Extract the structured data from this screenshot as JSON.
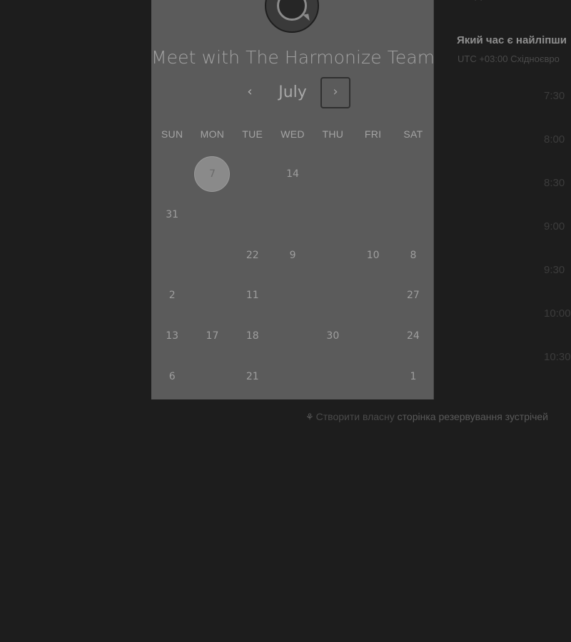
{
  "booking": {
    "title": "Meet with The Harmonize Team",
    "month": "July",
    "prev_icon": "‹",
    "next_icon": "›"
  },
  "calendar": {
    "weekdays": [
      "SUN",
      "MON",
      "TUE",
      "WED",
      "THU",
      "FRI",
      "SAT"
    ],
    "weeks": [
      [
        "",
        "7",
        "",
        "14",
        "",
        "",
        ""
      ],
      [
        "31",
        "",
        "",
        "",
        "",
        "",
        ""
      ],
      [
        "",
        "",
        "22",
        "9",
        "",
        "10",
        "8"
      ],
      [
        "2",
        "",
        "11",
        "",
        "",
        "",
        "27"
      ],
      [
        "13",
        "17",
        "18",
        "",
        "30",
        "",
        "24"
      ],
      [
        "6",
        "",
        "21",
        "",
        "",
        "",
        "1"
      ]
    ],
    "selected_day": "7"
  },
  "time_panel": {
    "top_fragment": "· ·",
    "question": "Який час є найліпши",
    "timezone": "UTC +03:00 Східноєвро",
    "slots": [
      "7:30",
      "8:00",
      "8:30",
      "9:00",
      "9:30",
      "10:00",
      "10:30"
    ]
  },
  "footer": {
    "icon": "⚘",
    "text": "Створити власну",
    "link": "сторінка резервування зустрічей"
  }
}
